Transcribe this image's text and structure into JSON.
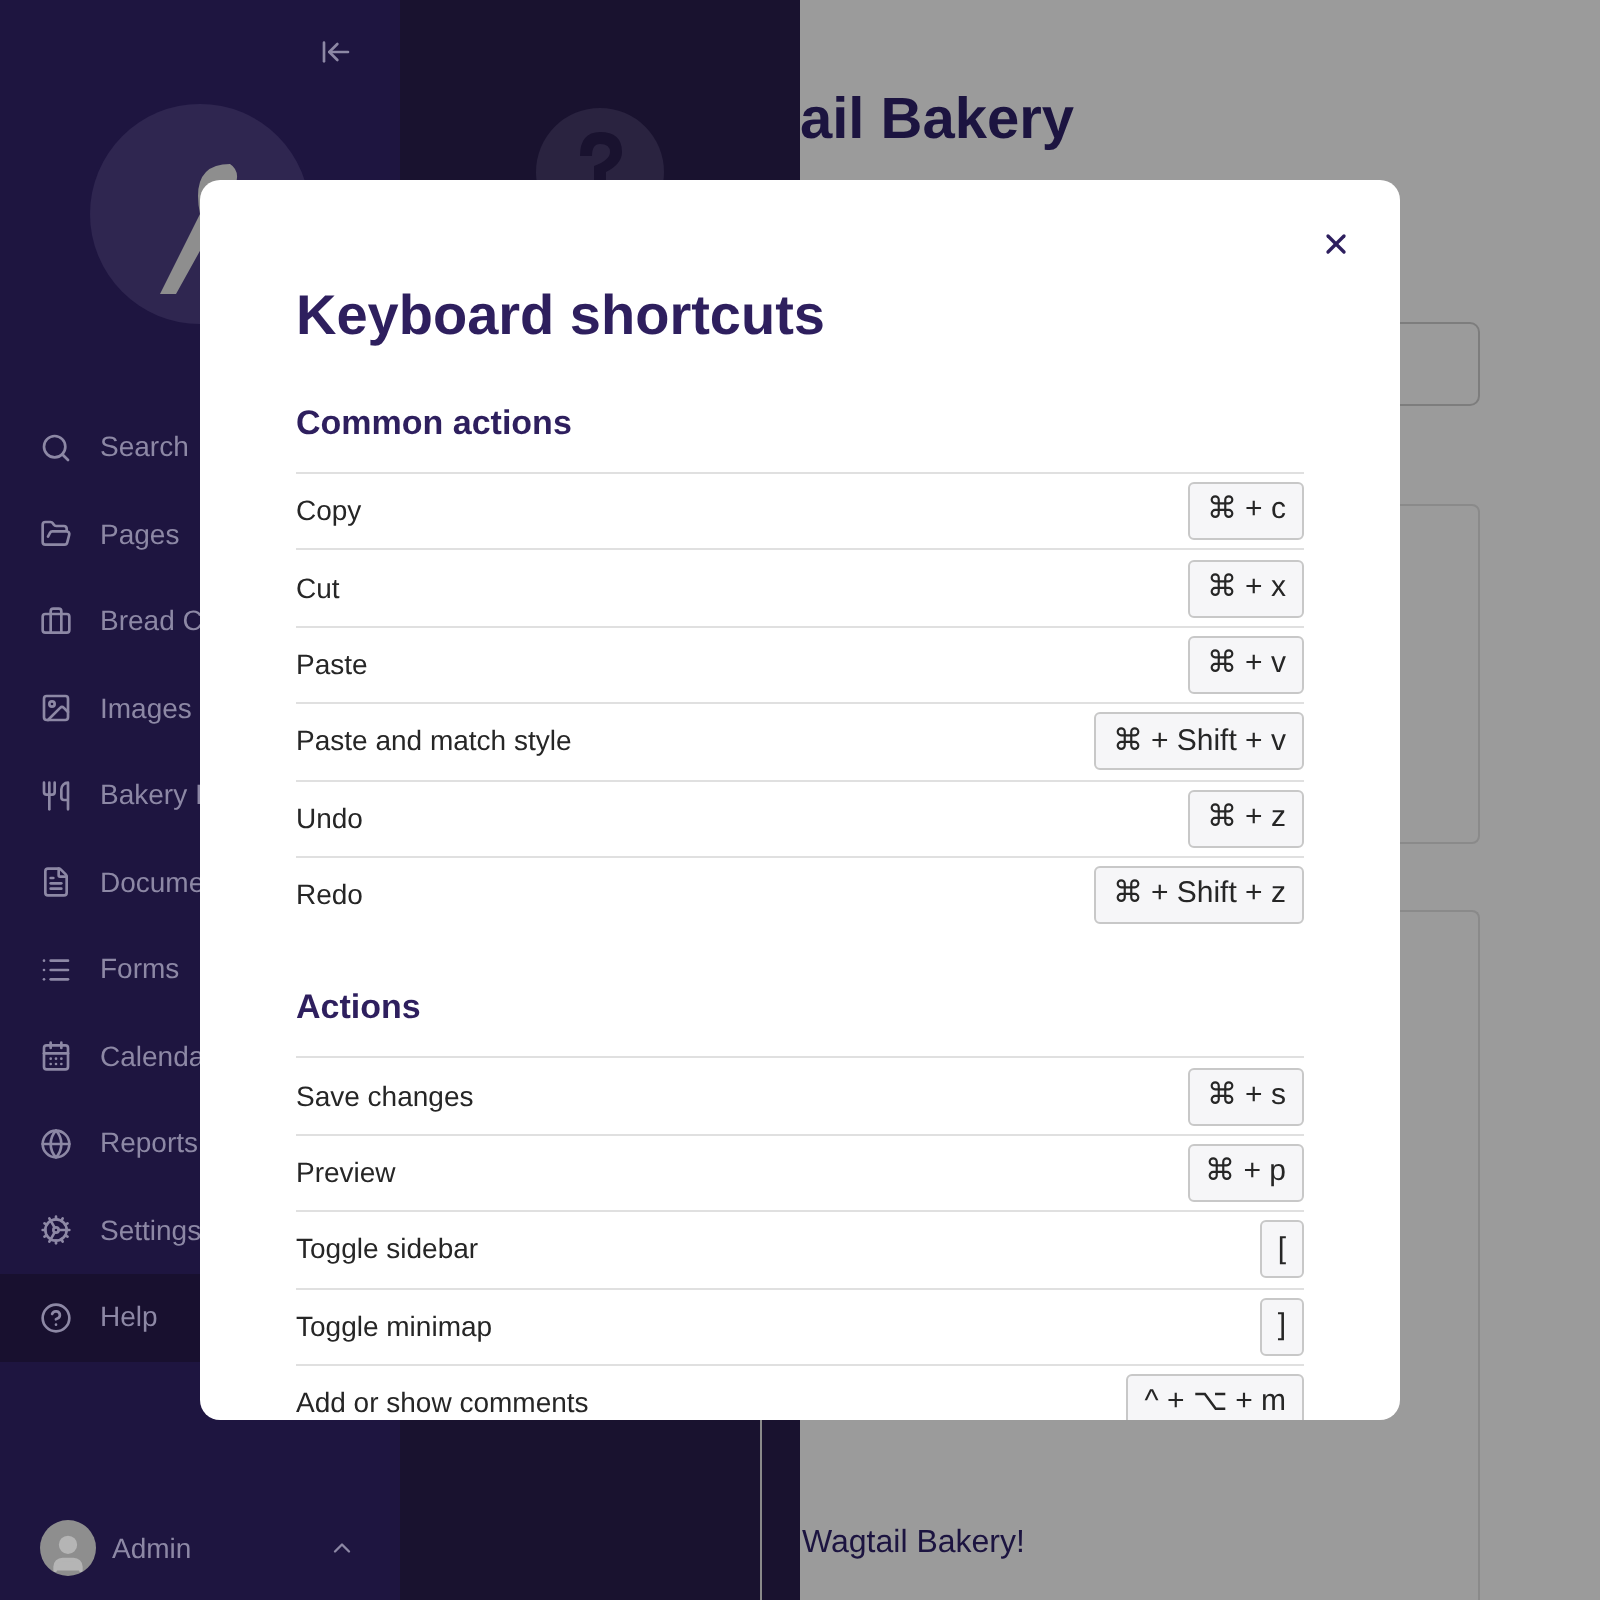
{
  "sidebar": {
    "items": [
      {
        "label": "Search",
        "selected": false
      },
      {
        "label": "Pages",
        "selected": false
      },
      {
        "label": "Bread C",
        "selected": false
      },
      {
        "label": "Images",
        "selected": false
      },
      {
        "label": "Bakery I",
        "selected": false
      },
      {
        "label": "Docume",
        "selected": false
      },
      {
        "label": "Forms",
        "selected": false
      },
      {
        "label": "Calenda",
        "selected": false
      },
      {
        "label": "Reports",
        "selected": false
      },
      {
        "label": "Settings",
        "selected": false
      },
      {
        "label": "Help",
        "selected": true
      }
    ],
    "user": "Admin"
  },
  "page": {
    "heading": "ail Bakery",
    "footer_text": "Wagtail Bakery!"
  },
  "dialog": {
    "title": "Keyboard shortcuts",
    "sections": [
      {
        "title": "Common actions",
        "rows": [
          {
            "label": "Copy",
            "keys": "⌘ + c"
          },
          {
            "label": "Cut",
            "keys": "⌘ + x"
          },
          {
            "label": "Paste",
            "keys": "⌘ + v"
          },
          {
            "label": "Paste and match style",
            "keys": "⌘ + Shift + v"
          },
          {
            "label": "Undo",
            "keys": "⌘ + z"
          },
          {
            "label": "Redo",
            "keys": "⌘ + Shift + z"
          }
        ]
      },
      {
        "title": "Actions",
        "rows": [
          {
            "label": "Save changes",
            "keys": "⌘ + s"
          },
          {
            "label": "Preview",
            "keys": "⌘ + p"
          },
          {
            "label": "Toggle sidebar",
            "keys": "["
          },
          {
            "label": "Toggle minimap",
            "keys": "]"
          },
          {
            "label": "Add or show comments",
            "keys": "^ + ⌥ + m"
          }
        ]
      }
    ]
  }
}
